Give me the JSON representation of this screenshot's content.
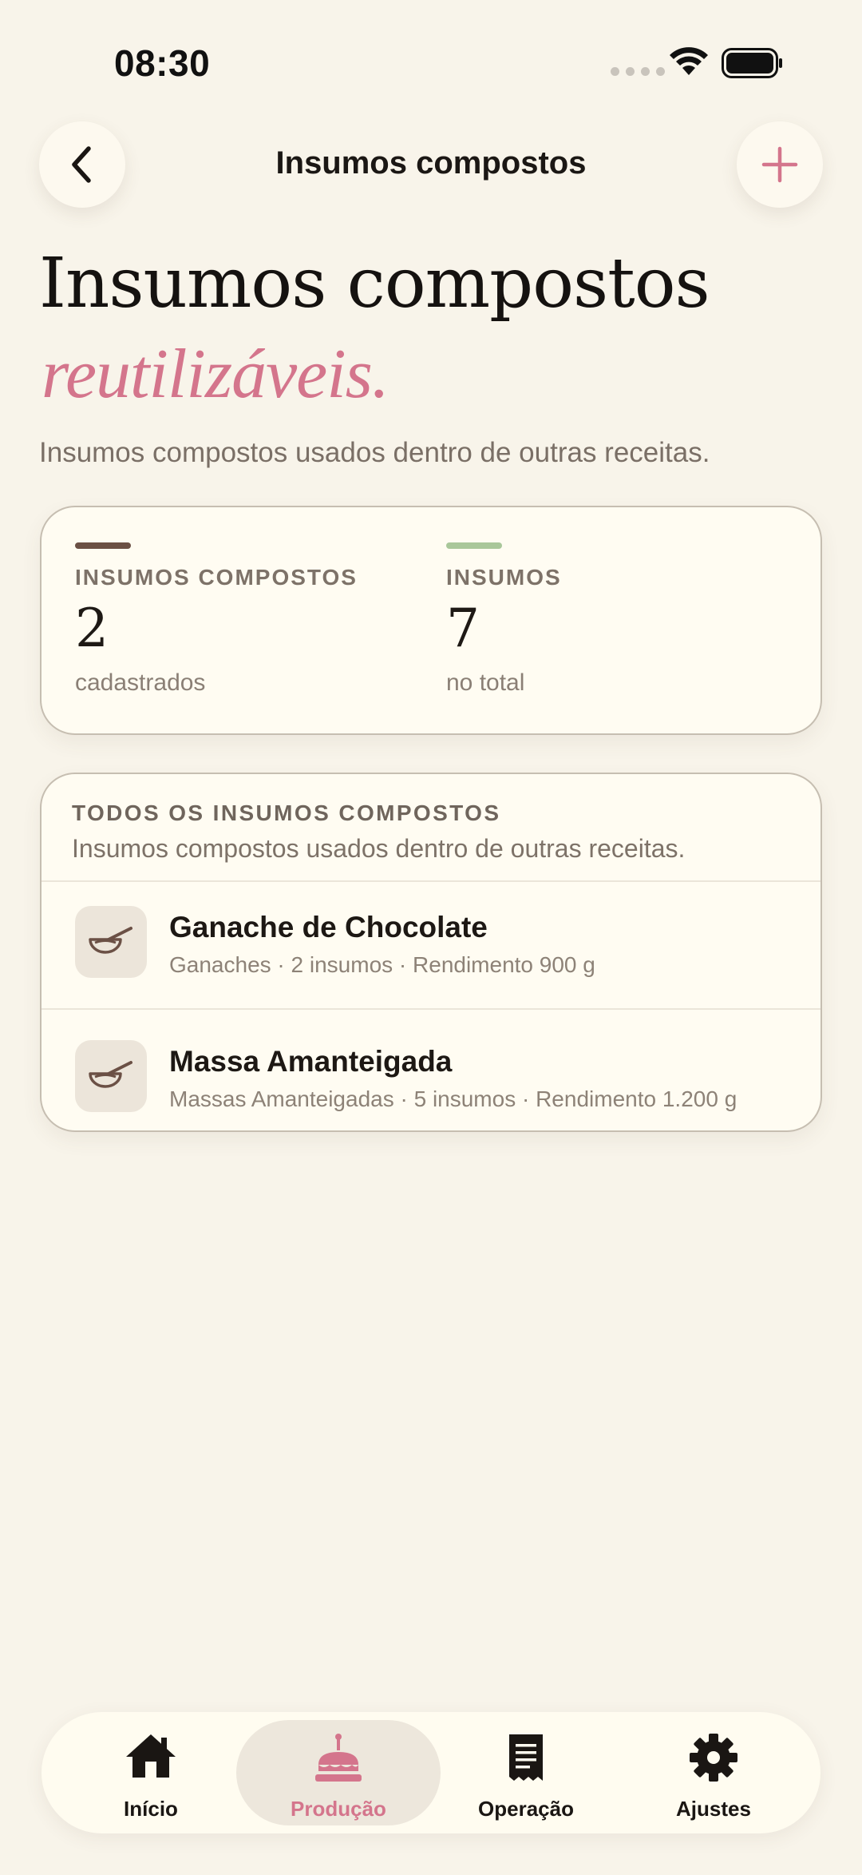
{
  "status_bar": {
    "time": "08:30"
  },
  "nav": {
    "title": "Insumos compostos"
  },
  "hero": {
    "title": "Insumos compostos",
    "accent": "reutilizáveis.",
    "subtitle": "Insumos compostos usados dentro de outras receitas."
  },
  "stats": [
    {
      "label": "INSUMOS COMPOSTOS",
      "value": "2",
      "note": "cadastrados",
      "accent_color": "#6b5045"
    },
    {
      "label": "INSUMOS",
      "value": "7",
      "note": "no total",
      "accent_color": "#a9c79a"
    }
  ],
  "list": {
    "title": "TODOS OS INSUMOS COMPOSTOS",
    "subtitle": "Insumos compostos usados dentro de outras receitas.",
    "items": [
      {
        "name": "Ganache de Chocolate",
        "meta": "Ganaches · 2 insumos · Rendimento 900 g",
        "icon": "mixing-bowl-icon"
      },
      {
        "name": "Massa Amanteigada",
        "meta": "Massas Amanteigadas · 5 insumos · Rendimento 1.200 g",
        "icon": "mixing-bowl-icon"
      }
    ]
  },
  "tabs": [
    {
      "label": "Início",
      "icon": "home-icon",
      "active": false
    },
    {
      "label": "Produção",
      "icon": "cake-icon",
      "active": true
    },
    {
      "label": "Operação",
      "icon": "receipt-icon",
      "active": false
    },
    {
      "label": "Ajustes",
      "icon": "gear-icon",
      "active": false
    }
  ],
  "colors": {
    "accent": "#d4758c",
    "background": "#f8f4ea",
    "card": "#fffcf2"
  }
}
